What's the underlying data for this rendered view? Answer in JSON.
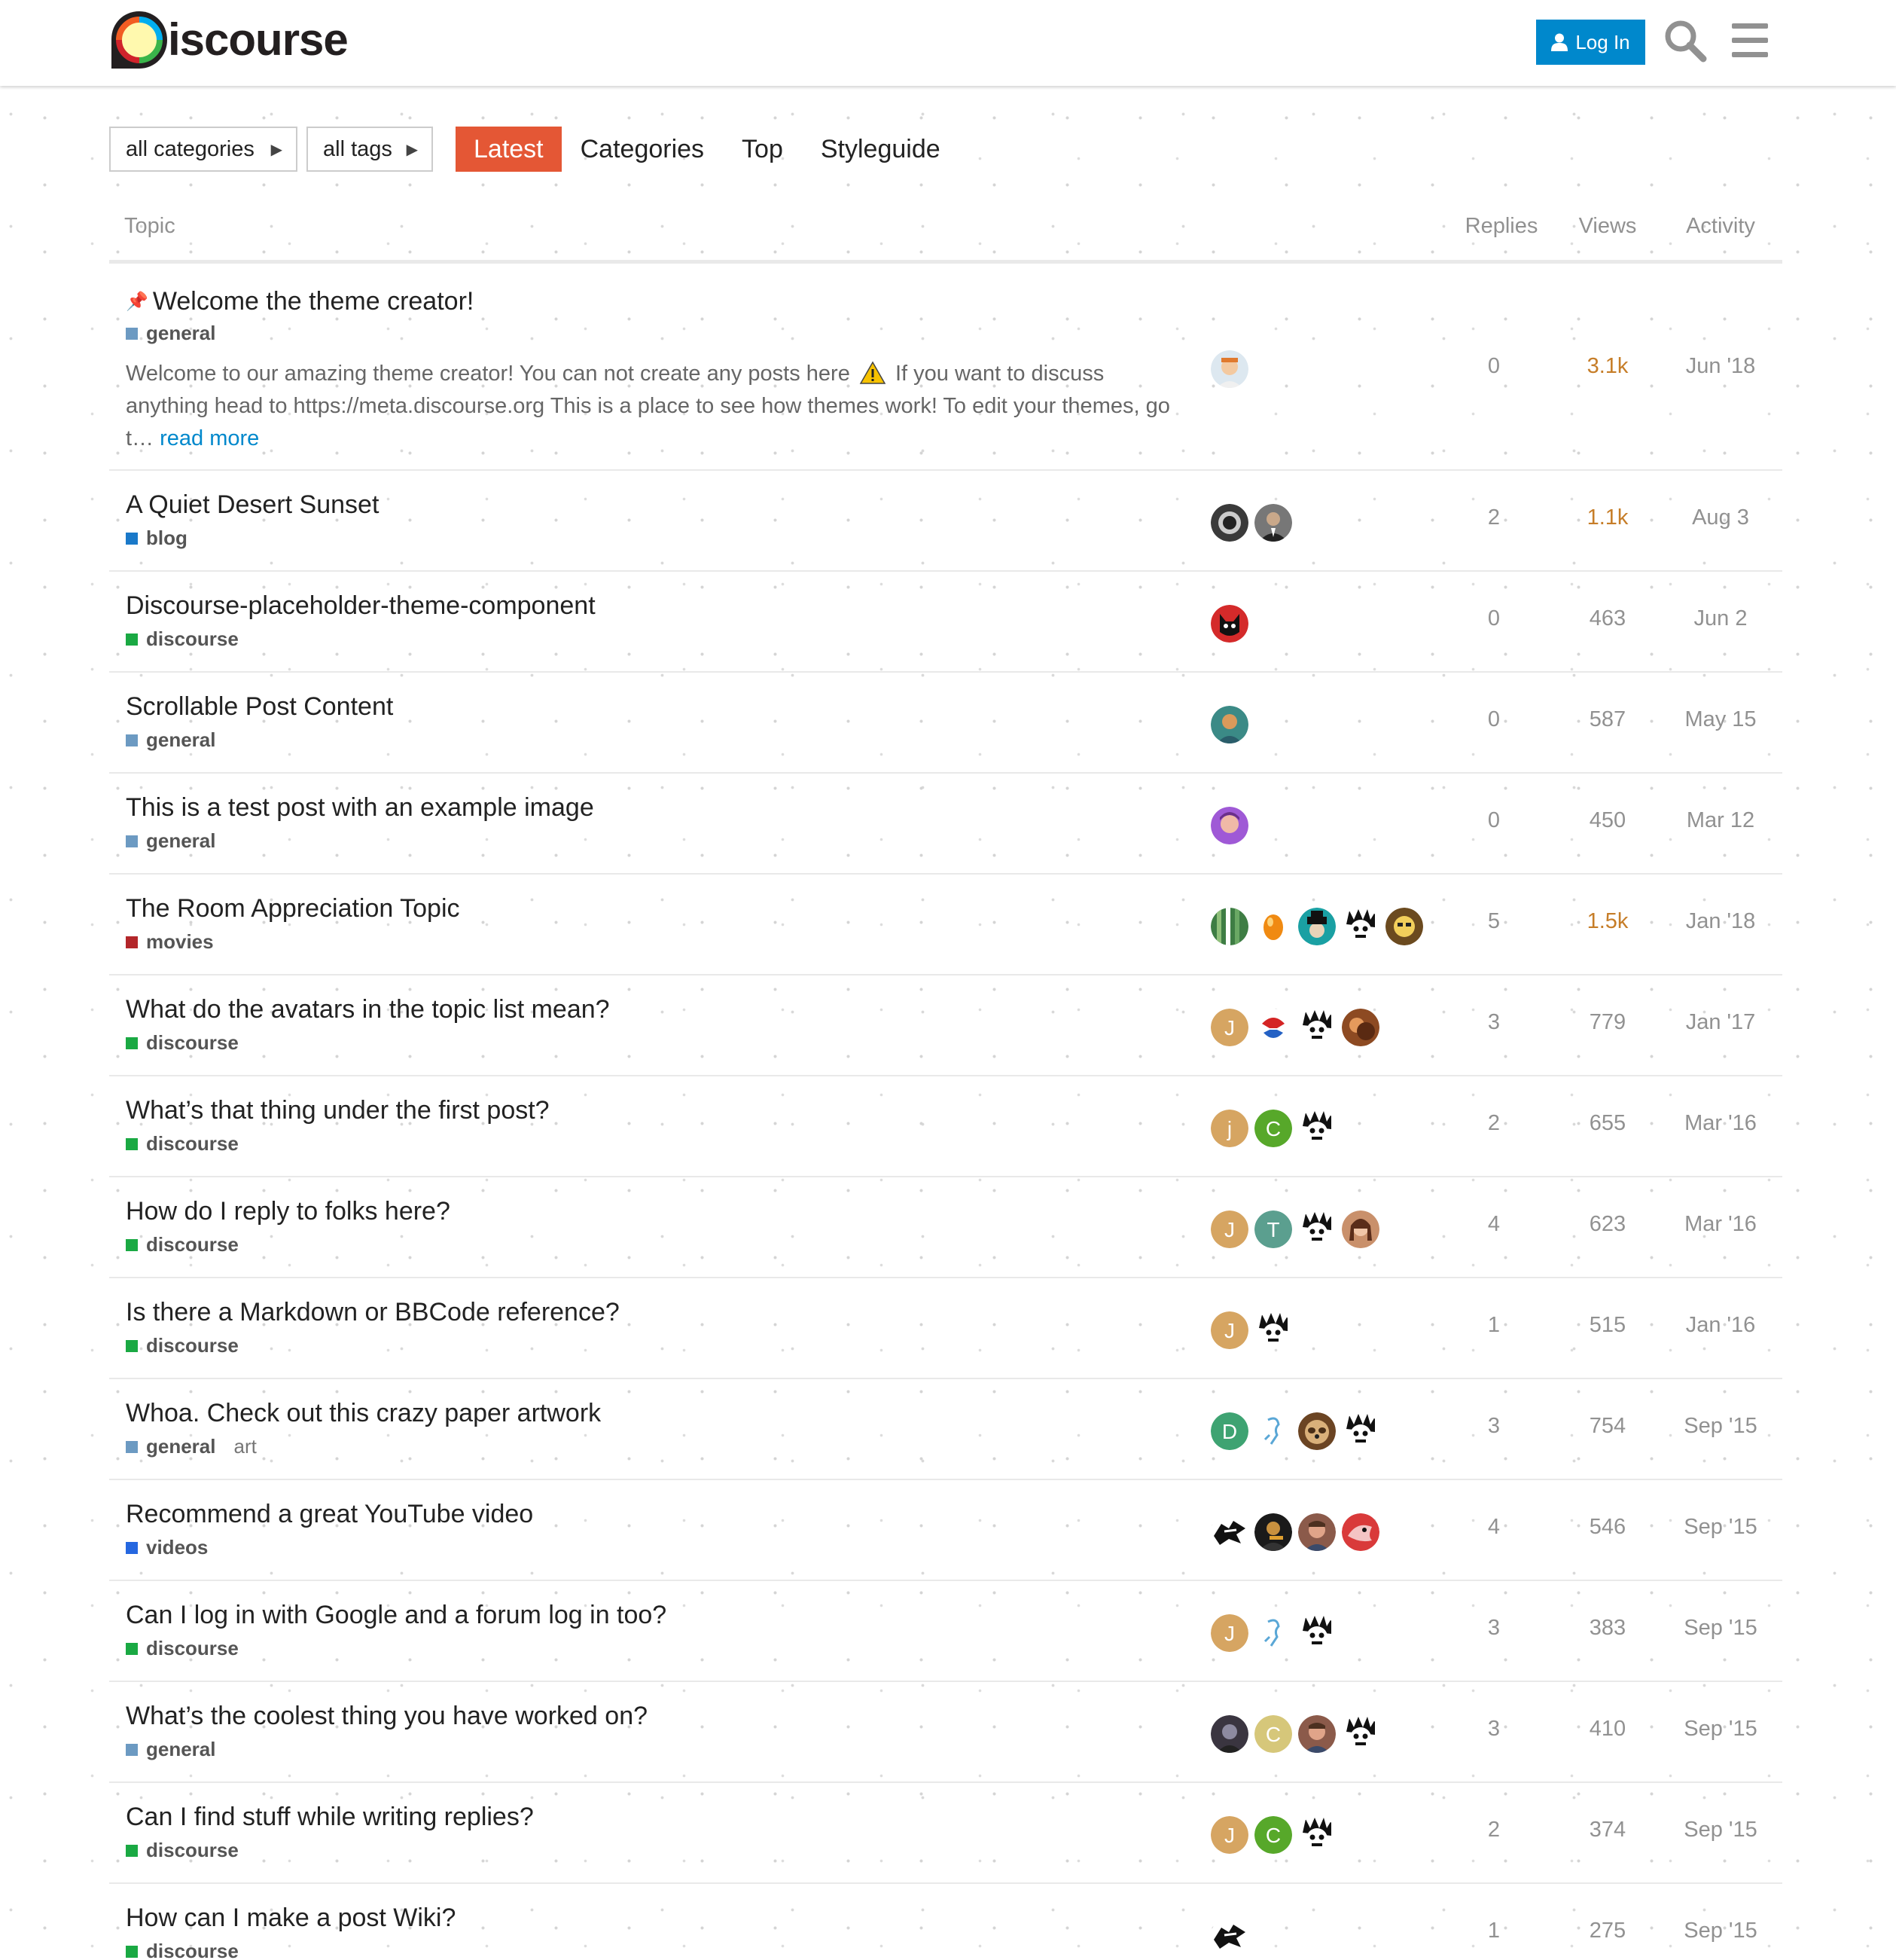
{
  "header": {
    "logo_text": "iscourse",
    "login_label": "Log In"
  },
  "nav": {
    "categories_dropdown": "all categories",
    "tags_dropdown": "all tags",
    "items": [
      {
        "label": "Latest",
        "active": true
      },
      {
        "label": "Categories",
        "active": false
      },
      {
        "label": "Top",
        "active": false
      },
      {
        "label": "Styleguide",
        "active": false
      }
    ]
  },
  "table": {
    "columns": {
      "topic": "Topic",
      "replies": "Replies",
      "views": "Views",
      "activity": "Activity"
    }
  },
  "categories": {
    "general": "#6c9ac2",
    "blog": "#1a79c9",
    "discourse": "#1aa943",
    "movies": "#b3262a",
    "videos": "#2567e0"
  },
  "topics": [
    {
      "title": "Welcome the theme creator!",
      "pinned": true,
      "category": "general",
      "excerpt_before": "Welcome to our amazing theme creator! You can not create any posts here",
      "excerpt_after": "If you want to discuss anything head to https://meta.discourse.org This is a place to see how themes work! To edit your themes, go t…",
      "read_more": "read more",
      "posters": [
        "face-orange"
      ],
      "replies": "0",
      "views": "3.1k",
      "views_hot": true,
      "activity": "Jun '18"
    },
    {
      "title": "A Quiet Desert Sunset",
      "category": "blog",
      "posters": [
        "dark-lens",
        "suit"
      ],
      "replies": "2",
      "views": "1.1k",
      "views_hot": true,
      "activity": "Aug 3"
    },
    {
      "title": "Discourse-placeholder-theme-component",
      "category": "discourse",
      "posters": [
        "cat-red"
      ],
      "replies": "0",
      "views": "463",
      "activity": "Jun 2"
    },
    {
      "title": "Scrollable Post Content",
      "category": "general",
      "posters": [
        "vangogh"
      ],
      "replies": "0",
      "views": "587",
      "activity": "May 15"
    },
    {
      "title": "This is a test post with an example image",
      "category": "general",
      "posters": [
        "purple-face"
      ],
      "replies": "0",
      "views": "450",
      "activity": "Mar 12"
    },
    {
      "title": "The Room Appreciation Topic",
      "category": "movies",
      "posters": [
        "stripes",
        "egg",
        "teal-hat",
        "bot",
        "yellow-face"
      ],
      "replies": "5",
      "views": "1.5k",
      "views_hot": true,
      "activity": "Jan '18"
    },
    {
      "title": "What do the avatars in the topic list mean?",
      "category": "discourse",
      "posters": [
        "J",
        "ball",
        "bot",
        "brown"
      ],
      "replies": "3",
      "views": "779",
      "activity": "Jan '17"
    },
    {
      "title": "What’s that thing under the first post?",
      "category": "discourse",
      "posters": [
        "j",
        "C",
        "bot"
      ],
      "replies": "2",
      "views": "655",
      "activity": "Mar '16"
    },
    {
      "title": "How do I reply to folks here?",
      "category": "discourse",
      "posters": [
        "J",
        "T",
        "bot",
        "woman"
      ],
      "replies": "4",
      "views": "623",
      "activity": "Mar '16"
    },
    {
      "title": "Is there a Markdown or BBCode reference?",
      "category": "discourse",
      "posters": [
        "J",
        "bot"
      ],
      "replies": "1",
      "views": "515",
      "activity": "Jan '16"
    },
    {
      "title": "Whoa. Check out this crazy paper artwork",
      "category": "general",
      "tag": "art",
      "posters": [
        "D",
        "sketch",
        "sloth",
        "bot"
      ],
      "replies": "3",
      "views": "754",
      "activity": "Sep '15"
    },
    {
      "title": "Recommend a great YouTube video",
      "category": "videos",
      "posters": [
        "ninja",
        "guitar",
        "man",
        "red-bird"
      ],
      "replies": "4",
      "views": "546",
      "activity": "Sep '15"
    },
    {
      "title": "Can I log in with Google and a forum log in too?",
      "category": "discourse",
      "posters": [
        "J",
        "sketch",
        "bot"
      ],
      "replies": "3",
      "views": "383",
      "activity": "Sep '15"
    },
    {
      "title": "What’s the coolest thing you have worked on?",
      "category": "general",
      "posters": [
        "dark-man",
        "C-light",
        "man",
        "bot"
      ],
      "replies": "3",
      "views": "410",
      "activity": "Sep '15"
    },
    {
      "title": "Can I find stuff while writing replies?",
      "category": "discourse",
      "posters": [
        "J",
        "C",
        "bot"
      ],
      "replies": "2",
      "views": "374",
      "activity": "Sep '15"
    },
    {
      "title": "How can I make a post Wiki?",
      "category": "discourse",
      "posters": [
        "ninja"
      ],
      "replies": "1",
      "views": "275",
      "activity": "Sep '15"
    }
  ]
}
